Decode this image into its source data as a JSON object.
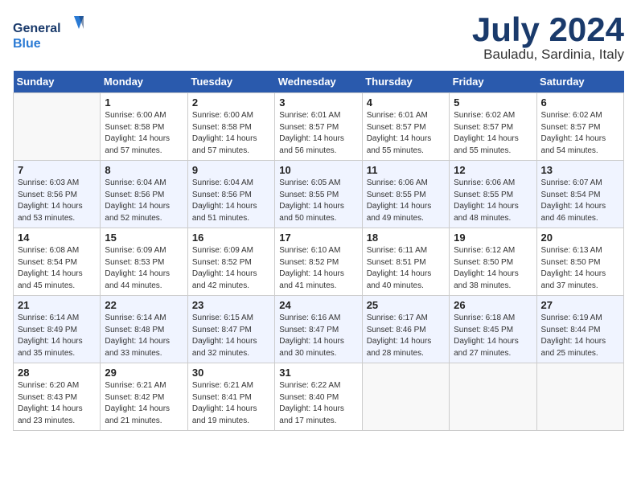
{
  "header": {
    "logo_general": "General",
    "logo_blue": "Blue",
    "month": "July 2024",
    "location": "Bauladu, Sardinia, Italy"
  },
  "weekdays": [
    "Sunday",
    "Monday",
    "Tuesday",
    "Wednesday",
    "Thursday",
    "Friday",
    "Saturday"
  ],
  "weeks": [
    [
      {
        "day": "",
        "info": ""
      },
      {
        "day": "1",
        "info": "Sunrise: 6:00 AM\nSunset: 8:58 PM\nDaylight: 14 hours\nand 57 minutes."
      },
      {
        "day": "2",
        "info": "Sunrise: 6:00 AM\nSunset: 8:58 PM\nDaylight: 14 hours\nand 57 minutes."
      },
      {
        "day": "3",
        "info": "Sunrise: 6:01 AM\nSunset: 8:57 PM\nDaylight: 14 hours\nand 56 minutes."
      },
      {
        "day": "4",
        "info": "Sunrise: 6:01 AM\nSunset: 8:57 PM\nDaylight: 14 hours\nand 55 minutes."
      },
      {
        "day": "5",
        "info": "Sunrise: 6:02 AM\nSunset: 8:57 PM\nDaylight: 14 hours\nand 55 minutes."
      },
      {
        "day": "6",
        "info": "Sunrise: 6:02 AM\nSunset: 8:57 PM\nDaylight: 14 hours\nand 54 minutes."
      }
    ],
    [
      {
        "day": "7",
        "info": "Sunrise: 6:03 AM\nSunset: 8:56 PM\nDaylight: 14 hours\nand 53 minutes."
      },
      {
        "day": "8",
        "info": "Sunrise: 6:04 AM\nSunset: 8:56 PM\nDaylight: 14 hours\nand 52 minutes."
      },
      {
        "day": "9",
        "info": "Sunrise: 6:04 AM\nSunset: 8:56 PM\nDaylight: 14 hours\nand 51 minutes."
      },
      {
        "day": "10",
        "info": "Sunrise: 6:05 AM\nSunset: 8:55 PM\nDaylight: 14 hours\nand 50 minutes."
      },
      {
        "day": "11",
        "info": "Sunrise: 6:06 AM\nSunset: 8:55 PM\nDaylight: 14 hours\nand 49 minutes."
      },
      {
        "day": "12",
        "info": "Sunrise: 6:06 AM\nSunset: 8:55 PM\nDaylight: 14 hours\nand 48 minutes."
      },
      {
        "day": "13",
        "info": "Sunrise: 6:07 AM\nSunset: 8:54 PM\nDaylight: 14 hours\nand 46 minutes."
      }
    ],
    [
      {
        "day": "14",
        "info": "Sunrise: 6:08 AM\nSunset: 8:54 PM\nDaylight: 14 hours\nand 45 minutes."
      },
      {
        "day": "15",
        "info": "Sunrise: 6:09 AM\nSunset: 8:53 PM\nDaylight: 14 hours\nand 44 minutes."
      },
      {
        "day": "16",
        "info": "Sunrise: 6:09 AM\nSunset: 8:52 PM\nDaylight: 14 hours\nand 42 minutes."
      },
      {
        "day": "17",
        "info": "Sunrise: 6:10 AM\nSunset: 8:52 PM\nDaylight: 14 hours\nand 41 minutes."
      },
      {
        "day": "18",
        "info": "Sunrise: 6:11 AM\nSunset: 8:51 PM\nDaylight: 14 hours\nand 40 minutes."
      },
      {
        "day": "19",
        "info": "Sunrise: 6:12 AM\nSunset: 8:50 PM\nDaylight: 14 hours\nand 38 minutes."
      },
      {
        "day": "20",
        "info": "Sunrise: 6:13 AM\nSunset: 8:50 PM\nDaylight: 14 hours\nand 37 minutes."
      }
    ],
    [
      {
        "day": "21",
        "info": "Sunrise: 6:14 AM\nSunset: 8:49 PM\nDaylight: 14 hours\nand 35 minutes."
      },
      {
        "day": "22",
        "info": "Sunrise: 6:14 AM\nSunset: 8:48 PM\nDaylight: 14 hours\nand 33 minutes."
      },
      {
        "day": "23",
        "info": "Sunrise: 6:15 AM\nSunset: 8:47 PM\nDaylight: 14 hours\nand 32 minutes."
      },
      {
        "day": "24",
        "info": "Sunrise: 6:16 AM\nSunset: 8:47 PM\nDaylight: 14 hours\nand 30 minutes."
      },
      {
        "day": "25",
        "info": "Sunrise: 6:17 AM\nSunset: 8:46 PM\nDaylight: 14 hours\nand 28 minutes."
      },
      {
        "day": "26",
        "info": "Sunrise: 6:18 AM\nSunset: 8:45 PM\nDaylight: 14 hours\nand 27 minutes."
      },
      {
        "day": "27",
        "info": "Sunrise: 6:19 AM\nSunset: 8:44 PM\nDaylight: 14 hours\nand 25 minutes."
      }
    ],
    [
      {
        "day": "28",
        "info": "Sunrise: 6:20 AM\nSunset: 8:43 PM\nDaylight: 14 hours\nand 23 minutes."
      },
      {
        "day": "29",
        "info": "Sunrise: 6:21 AM\nSunset: 8:42 PM\nDaylight: 14 hours\nand 21 minutes."
      },
      {
        "day": "30",
        "info": "Sunrise: 6:21 AM\nSunset: 8:41 PM\nDaylight: 14 hours\nand 19 minutes."
      },
      {
        "day": "31",
        "info": "Sunrise: 6:22 AM\nSunset: 8:40 PM\nDaylight: 14 hours\nand 17 minutes."
      },
      {
        "day": "",
        "info": ""
      },
      {
        "day": "",
        "info": ""
      },
      {
        "day": "",
        "info": ""
      }
    ]
  ]
}
